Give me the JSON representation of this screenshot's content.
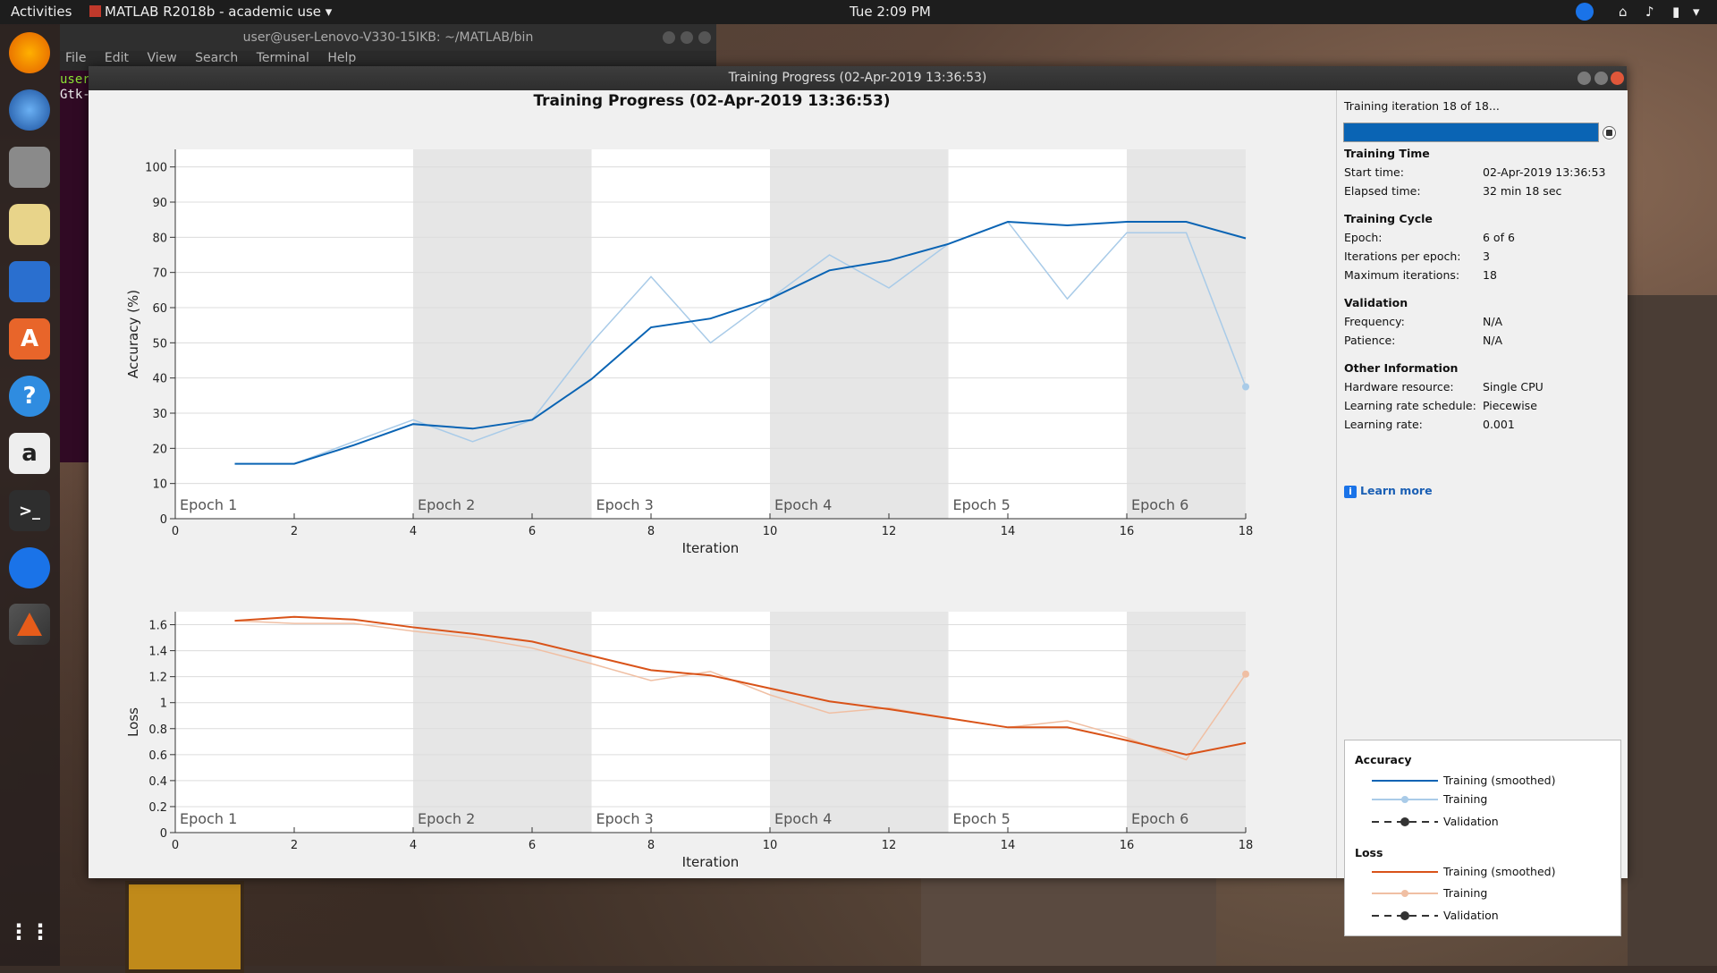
{
  "topbar": {
    "activities": "Activities",
    "app_menu": "MATLAB R2018b - academic use",
    "clock": "Tue  2:09 PM"
  },
  "terminal": {
    "title": "user@user-Lenovo-V330-15IKB: ~/MATLAB/bin",
    "menu": [
      "File",
      "Edit",
      "View",
      "Search",
      "Terminal",
      "Help"
    ],
    "lines": [
      "user",
      "Gtk-"
    ]
  },
  "window": {
    "title": "Training Progress (02-Apr-2019 13:36:53)"
  },
  "plot": {
    "title": "Training Progress (02-Apr-2019 13:36:53)"
  },
  "side": {
    "status": "Training iteration 18 of 18...",
    "progress": 1.0,
    "training_time": {
      "heading": "Training Time",
      "start_label": "Start time:",
      "start_value": "02-Apr-2019 13:36:53",
      "elapsed_label": "Elapsed time:",
      "elapsed_value": "32 min 18 sec"
    },
    "training_cycle": {
      "heading": "Training Cycle",
      "epoch_label": "Epoch:",
      "epoch_value": "6 of 6",
      "ipe_label": "Iterations per epoch:",
      "ipe_value": "3",
      "max_label": "Maximum iterations:",
      "max_value": "18"
    },
    "validation": {
      "heading": "Validation",
      "freq_label": "Frequency:",
      "freq_value": "N/A",
      "pat_label": "Patience:",
      "pat_value": "N/A"
    },
    "other": {
      "heading": "Other Information",
      "hw_label": "Hardware resource:",
      "hw_value": "Single CPU",
      "lr_sched_label": "Learning rate schedule:",
      "lr_sched_value": "Piecewise",
      "lr_label": "Learning rate:",
      "lr_value": "0.001"
    },
    "learn_more": "Learn more"
  },
  "legend": {
    "accuracy_heading": "Accuracy",
    "loss_heading": "Loss",
    "smoothed": "Training (smoothed)",
    "training": "Training",
    "validation": "Validation"
  },
  "colors": {
    "acc_smoothed": "#0a64b4",
    "acc_raw": "#a9cbe8",
    "loss_smoothed": "#d95319",
    "loss_raw": "#f0bfa3",
    "epoch_shade": "#e6e6e6"
  },
  "chart_data": [
    {
      "type": "line",
      "xlabel": "Iteration",
      "ylabel": "Accuracy (%)",
      "xlim": [
        0,
        18
      ],
      "ylim": [
        0,
        105
      ],
      "xticks": [
        0,
        2,
        4,
        6,
        8,
        10,
        12,
        14,
        16,
        18
      ],
      "yticks": [
        0,
        10,
        20,
        30,
        40,
        50,
        60,
        70,
        80,
        90,
        100
      ],
      "grid": true,
      "epochs": [
        "Epoch 1",
        "Epoch 2",
        "Epoch 3",
        "Epoch 4",
        "Epoch 5",
        "Epoch 6"
      ],
      "epoch_bounds": [
        0,
        4,
        7,
        10,
        13,
        16,
        18
      ],
      "x": [
        1,
        2,
        3,
        4,
        5,
        6,
        7,
        8,
        9,
        10,
        11,
        12,
        13,
        14,
        15,
        16,
        17,
        18
      ],
      "series": [
        {
          "name": "Training (smoothed)",
          "values": [
            15.6,
            15.6,
            20.9,
            26.9,
            25.6,
            28.1,
            39.7,
            54.4,
            56.9,
            62.5,
            70.6,
            73.4,
            78.1,
            84.4,
            83.4,
            84.4,
            84.4,
            79.7
          ]
        },
        {
          "name": "Training",
          "values": [
            15.6,
            15.6,
            21.9,
            28.1,
            21.9,
            28.1,
            50.0,
            68.8,
            50.0,
            62.5,
            75.0,
            65.6,
            78.1,
            84.4,
            62.5,
            81.3,
            81.3,
            37.5
          ]
        }
      ]
    },
    {
      "type": "line",
      "xlabel": "Iteration",
      "ylabel": "Loss",
      "xlim": [
        0,
        18
      ],
      "ylim": [
        0,
        1.7
      ],
      "xticks": [
        0,
        2,
        4,
        6,
        8,
        10,
        12,
        14,
        16,
        18
      ],
      "yticks": [
        0,
        0.2,
        0.4,
        0.6,
        0.8,
        1,
        1.2,
        1.4,
        1.6
      ],
      "grid": true,
      "epochs": [
        "Epoch 1",
        "Epoch 2",
        "Epoch 3",
        "Epoch 4",
        "Epoch 5",
        "Epoch 6"
      ],
      "epoch_bounds": [
        0,
        4,
        7,
        10,
        13,
        16,
        18
      ],
      "x": [
        1,
        2,
        3,
        4,
        5,
        6,
        7,
        8,
        9,
        10,
        11,
        12,
        13,
        14,
        15,
        16,
        17,
        18
      ],
      "series": [
        {
          "name": "Training (smoothed)",
          "values": [
            1.63,
            1.66,
            1.64,
            1.58,
            1.53,
            1.47,
            1.36,
            1.25,
            1.21,
            1.11,
            1.01,
            0.95,
            0.88,
            0.81,
            0.81,
            0.71,
            0.6,
            0.69
          ]
        },
        {
          "name": "Training",
          "values": [
            1.63,
            1.61,
            1.61,
            1.55,
            1.5,
            1.42,
            1.3,
            1.17,
            1.24,
            1.06,
            0.92,
            0.96,
            0.88,
            0.81,
            0.86,
            0.73,
            0.56,
            1.22
          ]
        }
      ]
    }
  ]
}
